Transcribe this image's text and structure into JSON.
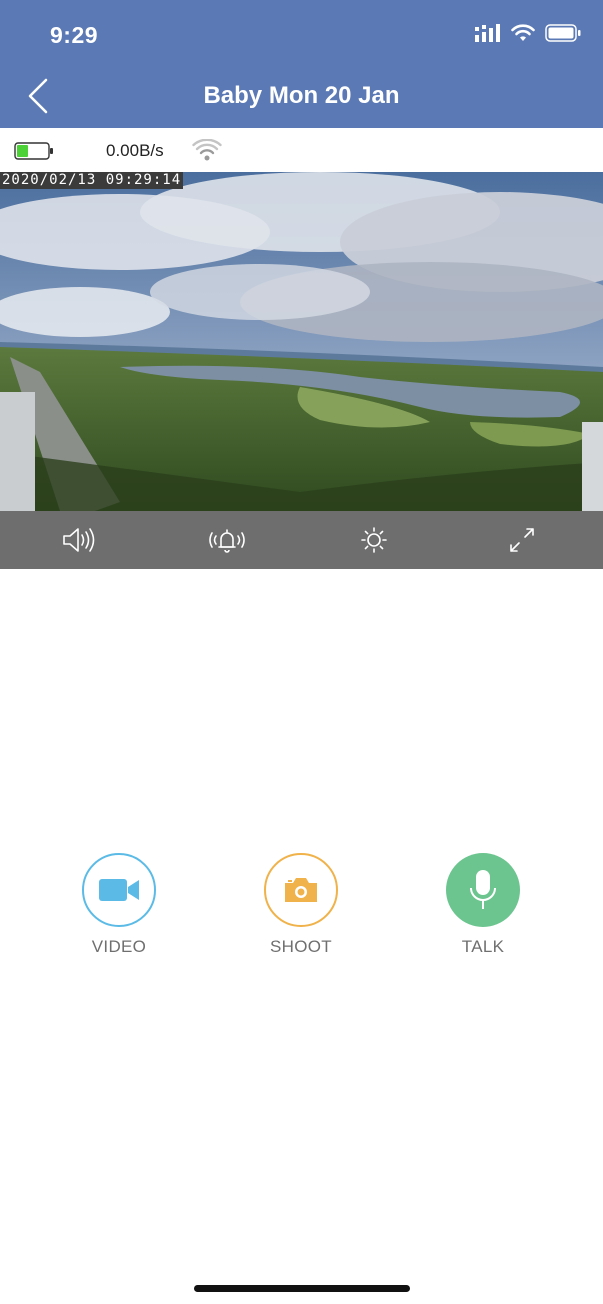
{
  "status_bar": {
    "time": "9:29"
  },
  "nav": {
    "title": "Baby Mon 20 Jan",
    "back_icon": "chevron-left-icon"
  },
  "info": {
    "speed": "0.00B/s",
    "battery_level": 0.35,
    "battery_color": "#4cd137"
  },
  "video": {
    "timestamp": "2020/02/13 09:29:14"
  },
  "controls": [
    {
      "icon": "speaker-icon"
    },
    {
      "icon": "alarm-bell-icon"
    },
    {
      "icon": "brightness-icon"
    },
    {
      "icon": "fullscreen-icon"
    }
  ],
  "actions": {
    "video": {
      "label": "VIDEO",
      "color": "#5bbbe6"
    },
    "shoot": {
      "label": "SHOOT",
      "color": "#f0b24a"
    },
    "talk": {
      "label": "TALK",
      "color": "#6cc58f"
    }
  },
  "colors": {
    "header": "#5b79b4",
    "controls_bar": "#6e6e6e"
  }
}
